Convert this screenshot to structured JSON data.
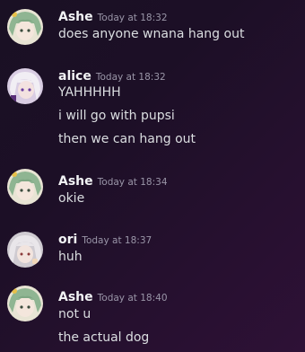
{
  "messages": [
    {
      "author": "Ashe",
      "timestamp": "Today at 18:32",
      "avatar_icon": "green-hair-anime-avatar-icon",
      "lines": [
        "does anyone wnana hang out"
      ]
    },
    {
      "author": "alice",
      "timestamp": "Today at 18:32",
      "avatar_icon": "white-hair-anime-avatar-icon",
      "lines": [
        "YAHHHHH",
        "i will go with pupsi",
        "then we can hang out"
      ]
    },
    {
      "author": "Ashe",
      "timestamp": "Today at 18:34",
      "avatar_icon": "green-hair-anime-avatar-icon",
      "lines": [
        "okie"
      ]
    },
    {
      "author": "ori",
      "timestamp": "Today at 18:37",
      "avatar_icon": "silver-hair-anime-avatar-icon",
      "lines": [
        "huh"
      ]
    },
    {
      "author": "Ashe",
      "timestamp": "Today at 18:40",
      "avatar_icon": "green-hair-anime-avatar-icon",
      "lines": [
        "not u",
        "the actual dog"
      ]
    }
  ],
  "colors": {
    "author": "#f2f3f5",
    "timestamp": "#9a96a8",
    "text": "#dbdee1",
    "background_start": "#1a1024",
    "background_end": "#2e1136"
  }
}
